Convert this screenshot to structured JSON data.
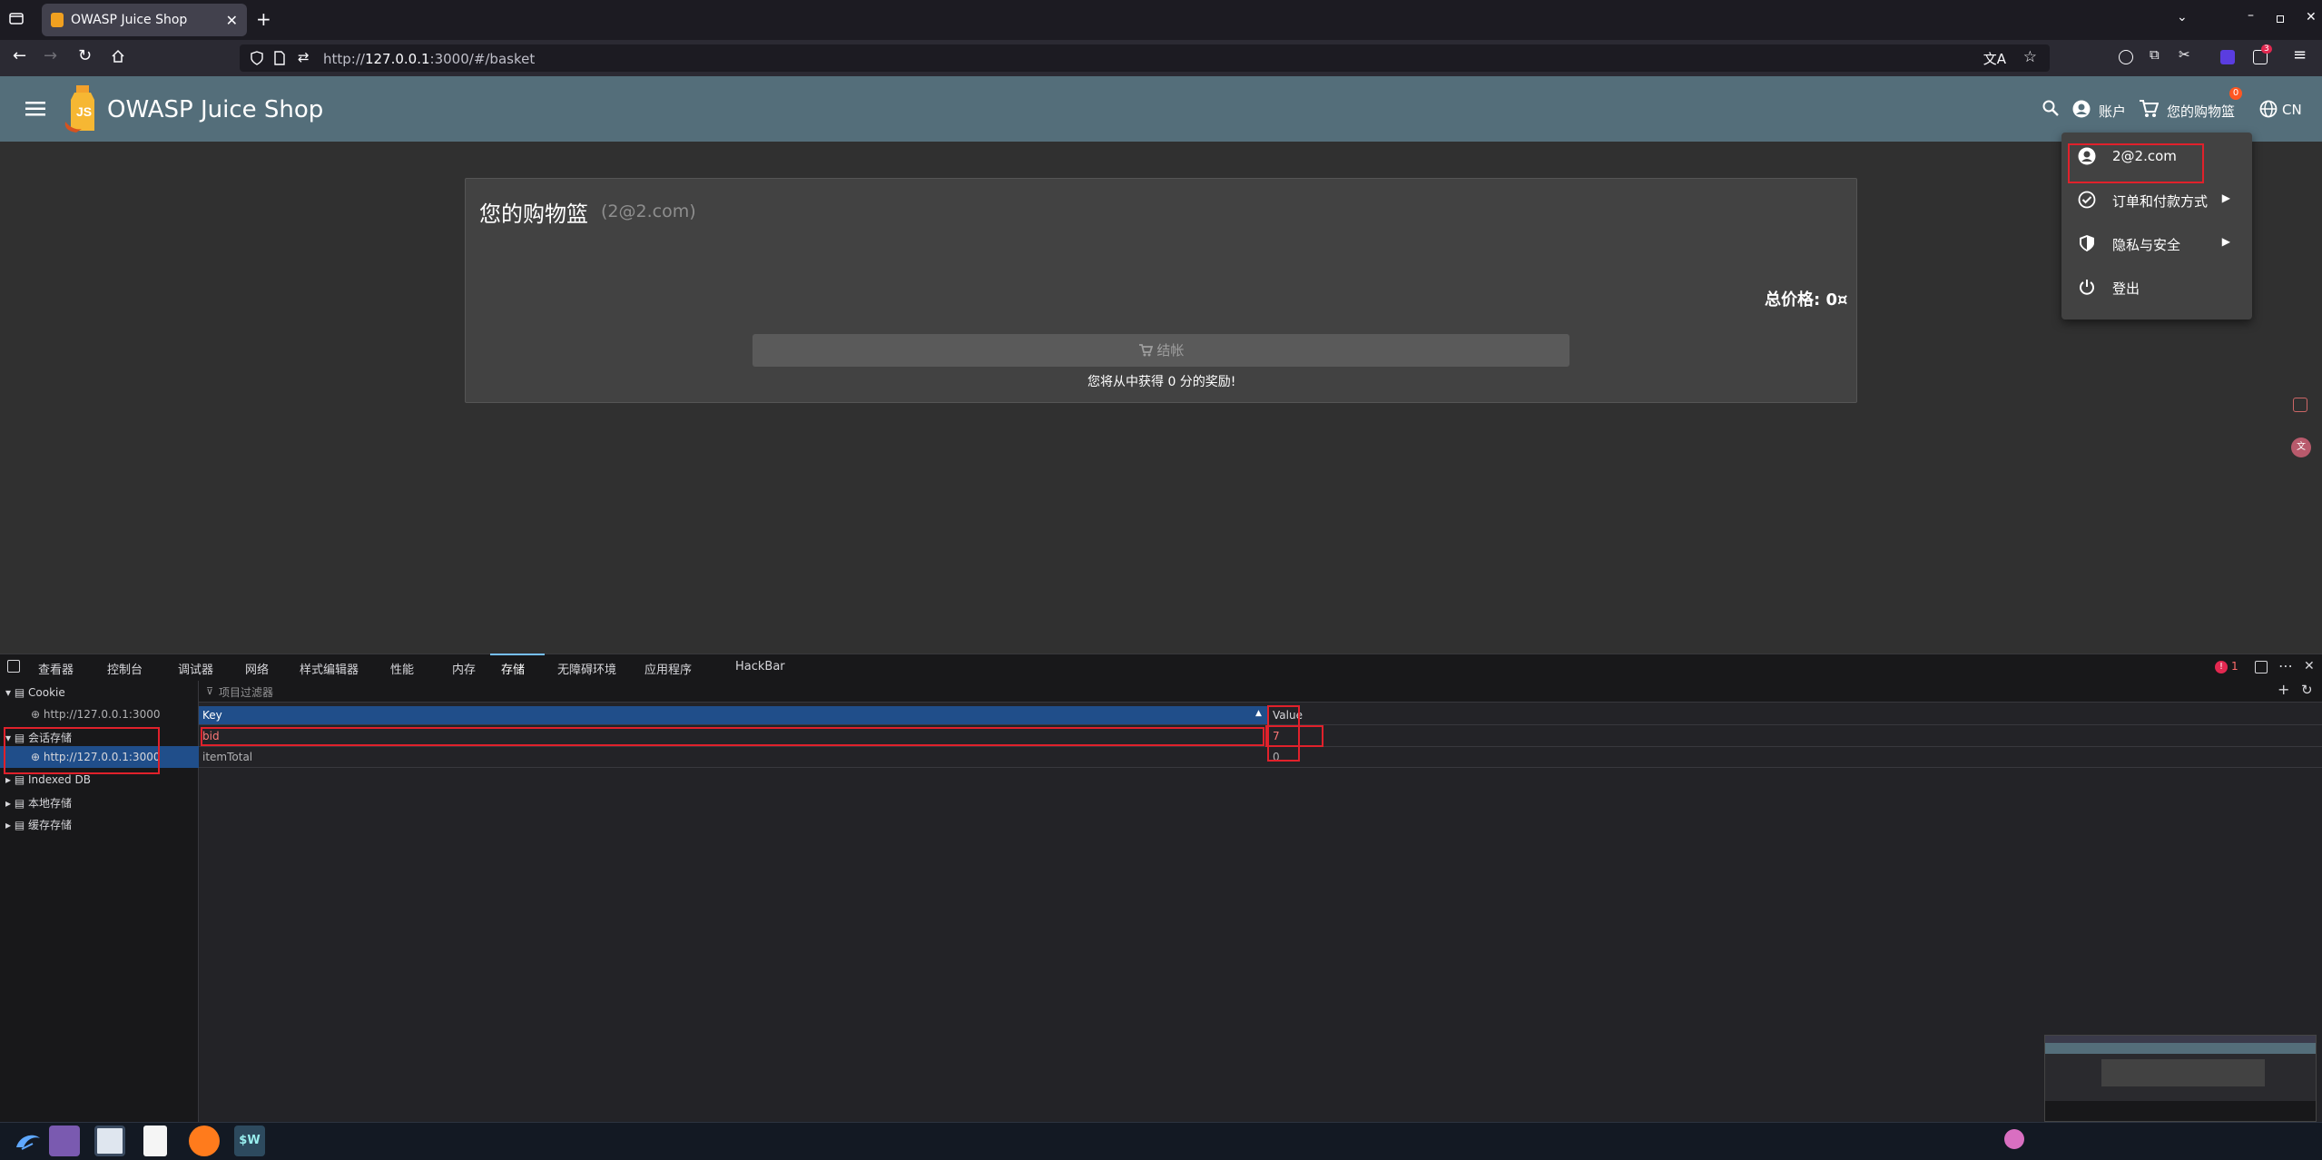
{
  "browser": {
    "tab_title": "OWASP Juice Shop",
    "url_prefix": "http://",
    "url_host": "127.0.0.1",
    "url_rest": ":3000/#/basket",
    "notification_count": "3"
  },
  "header": {
    "app_title": "OWASP Juice Shop",
    "account_label": "账户",
    "basket_label": "您的购物篮",
    "basket_count": "0",
    "language": "CN"
  },
  "basket": {
    "title": "您的购物篮",
    "subtitle": "(2@2.com)",
    "total_label": "总价格: 0¤",
    "checkout_label": "结帐",
    "bonus_text": "您将从中获得 0 分的奖励!"
  },
  "account_menu": {
    "items": [
      {
        "label": "2@2.com",
        "icon": "account-circle-icon"
      },
      {
        "label": "订单和付款方式",
        "icon": "check-circle-icon"
      },
      {
        "label": "隐私与安全",
        "icon": "shield-icon"
      },
      {
        "label": "登出",
        "icon": "power-icon"
      }
    ]
  },
  "devtools": {
    "tabs": [
      "查看器",
      "控制台",
      "调试器",
      "网络",
      "样式编辑器",
      "性能",
      "内存",
      "存储",
      "无障碍环境",
      "应用程序",
      "HackBar"
    ],
    "selected_tab": "存储",
    "error_count": "1",
    "filter_placeholder": "项目过滤器",
    "tree": [
      {
        "label": "Cookie",
        "children": [
          "http://127.0.0.1:3000"
        ]
      },
      {
        "label": "会话存储",
        "children": [
          "http://127.0.0.1:3000"
        ]
      },
      {
        "label": "Indexed DB"
      },
      {
        "label": "本地存储"
      },
      {
        "label": "缓存存储"
      }
    ],
    "table": {
      "columns": [
        "Key",
        "Value"
      ],
      "rows": [
        {
          "key": "bid",
          "value": "7"
        },
        {
          "key": "itemTotal",
          "value": "0"
        }
      ]
    }
  },
  "colors": {
    "header_bg": "#546e7a",
    "page_bg": "#303030",
    "card_bg": "#424242",
    "highlight": "#e0212b",
    "devtools_selected": "#204e8a"
  }
}
